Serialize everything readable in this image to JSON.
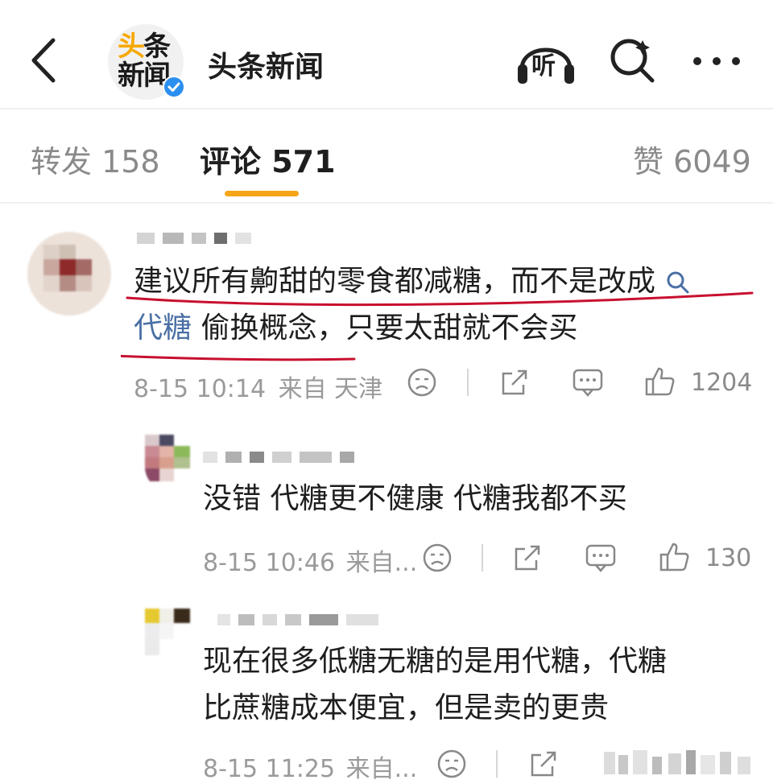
{
  "header": {
    "account_name": "头条新闻",
    "logo_line1_a": "头",
    "logo_line1_b": "条",
    "logo_line2": "新闻",
    "listen_label": "听"
  },
  "tabs": [
    {
      "label": "转发 158"
    },
    {
      "label": "评论 571"
    },
    {
      "label": "赞 6049"
    }
  ],
  "comments": [
    {
      "text_line1": "建议所有齁甜的零食都减糖，而不是改成",
      "link_word": "代糖",
      "text_line2_rest": "偷换概念，只要太甜就不会买",
      "time": "8-15 10:14",
      "location": "来自 天津",
      "likes": "1204"
    },
    {
      "text": "没错 代糖更不健康 代糖我都不买",
      "time": "8-15 10:46",
      "location": "来自...",
      "likes": "130"
    },
    {
      "text_line1": "现在很多低糖无糖的是用代糖，代糖",
      "text_line2": "比蔗糖成本便宜，但是卖的更贵",
      "time": "8-15 11:25",
      "location": "来自..."
    }
  ],
  "colors": {
    "accent": "#f6a516",
    "link": "#4a6fa5",
    "annotation": "#c8102e",
    "verified": "#2b8ff0"
  },
  "icons": [
    "back-arrow-icon",
    "verified-badge-icon",
    "headphones-icon",
    "search-icon",
    "more-icon",
    "dislike-face-icon",
    "share-icon",
    "comment-icon",
    "thumbs-up-icon"
  ]
}
